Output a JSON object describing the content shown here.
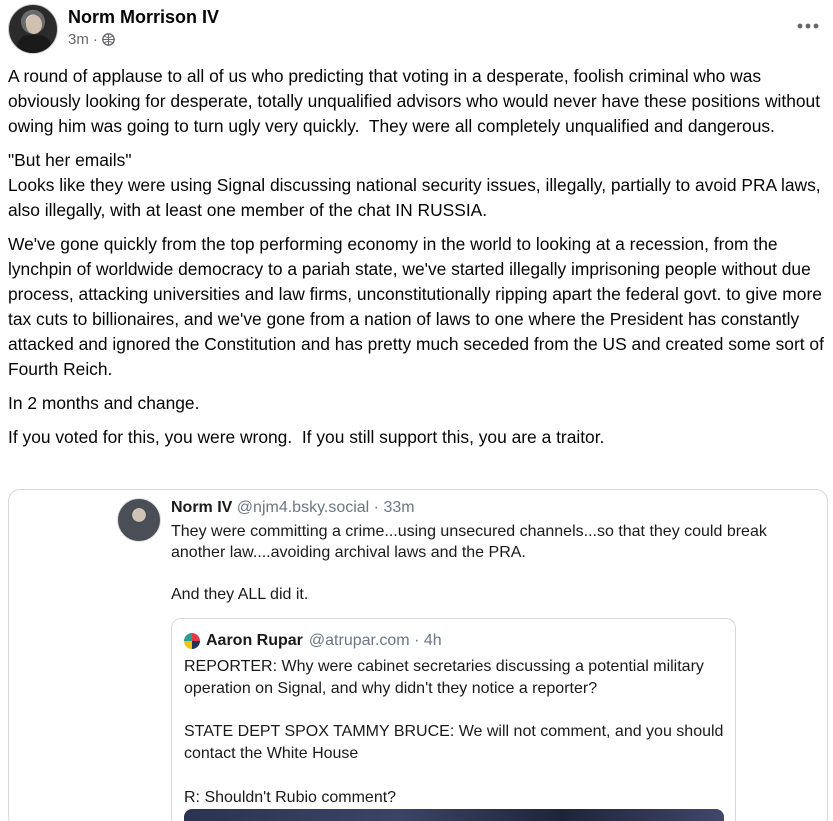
{
  "post": {
    "author": "Norm Morrison IV",
    "time": "3m",
    "separator": "·",
    "audience_icon": "globe-icon",
    "more_icon": "more-options-icon",
    "paragraphs": [
      "A round of applause to all of us who predicting that voting in a desperate, foolish criminal who was obviously looking for desperate, totally unqualified advisors who would never have these positions without owing him was going to turn ugly very quickly.  They were all completely unqualified and dangerous.",
      "\"But her emails\"\nLooks like they were using Signal discussing national security issues, illegally, partially to avoid PRA laws, also illegally, with at least one member of the chat IN RUSSIA.",
      "We've gone quickly from the top performing economy in the world to looking at a recession, from the lynchpin of worldwide democracy to a pariah state, we've started illegally imprisoning people without due process, attacking universities and law firms, unconstitutionally ripping apart the federal govt. to give more tax cuts to billionaires, and we've gone from a nation of laws to one where the President has constantly attacked and ignored the Constitution and has pretty much seceded from the US and created some sort of Fourth Reich.",
      "In 2 months and change.",
      "If you voted for this, you were wrong.  If you still support this, you are a traitor."
    ]
  },
  "embed": {
    "name": "Norm IV",
    "handle": "@njm4.bsky.social · 33m",
    "text": "They were committing a crime...using unsecured channels...so that they could break another law....avoiding archival laws and the PRA.\n\nAnd they ALL did it.",
    "quote": {
      "name": "Aaron Rupar",
      "handle": "@atrupar.com · 4h",
      "text": "REPORTER: Why were cabinet secretaries discussing a potential military operation on Signal, and why didn't they notice a reporter?\n\nSTATE DEPT SPOX TAMMY BRUCE: We will not comment, and you should contact the White House\n\nR: Shouldn't Rubio comment?"
    }
  }
}
